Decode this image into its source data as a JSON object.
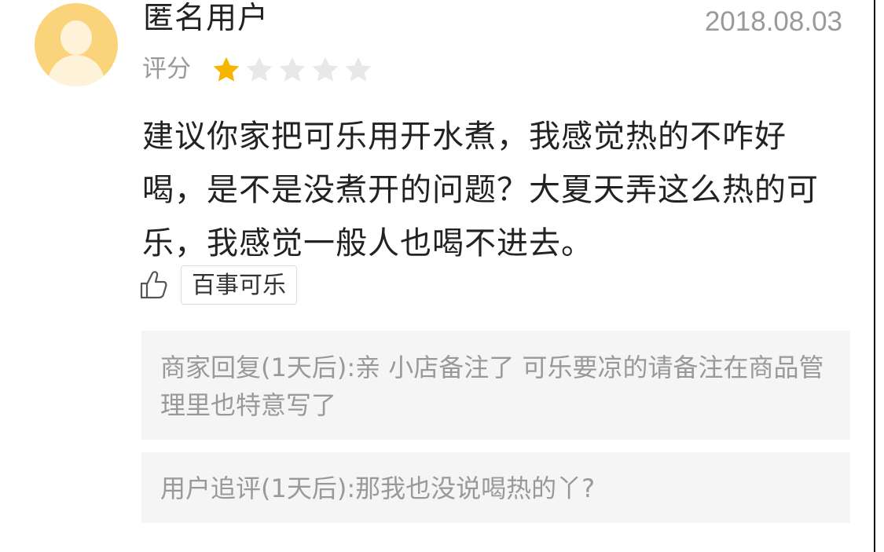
{
  "review": {
    "user_name": "匿名用户",
    "date": "2018.08.03",
    "rating_label": "评分",
    "rating": 1,
    "rating_max": 5,
    "content": "建议你家把可乐用开水煮，我感觉热的不咋好喝，是不是没煮开的问题？大夏天弄这么热的可乐，我感觉一般人也喝不进去。",
    "tag": "百事可乐",
    "avatar_icon": "default-user-avatar-icon",
    "like_icon": "thumbs-up-icon"
  },
  "merchant_reply": {
    "text": "商家回复(1天后):亲 小店备注了 可乐要凉的请备注在商品管理里也特意写了"
  },
  "user_followup": {
    "text": "用户追评(1天后):那我也没说喝热的丫?"
  },
  "colors": {
    "avatar_bg": "#fbd37a",
    "star_active": "#f7b500",
    "star_inactive": "#e8e8e8",
    "muted_text": "#9a9a9a",
    "reply_bg": "#f5f5f5"
  }
}
